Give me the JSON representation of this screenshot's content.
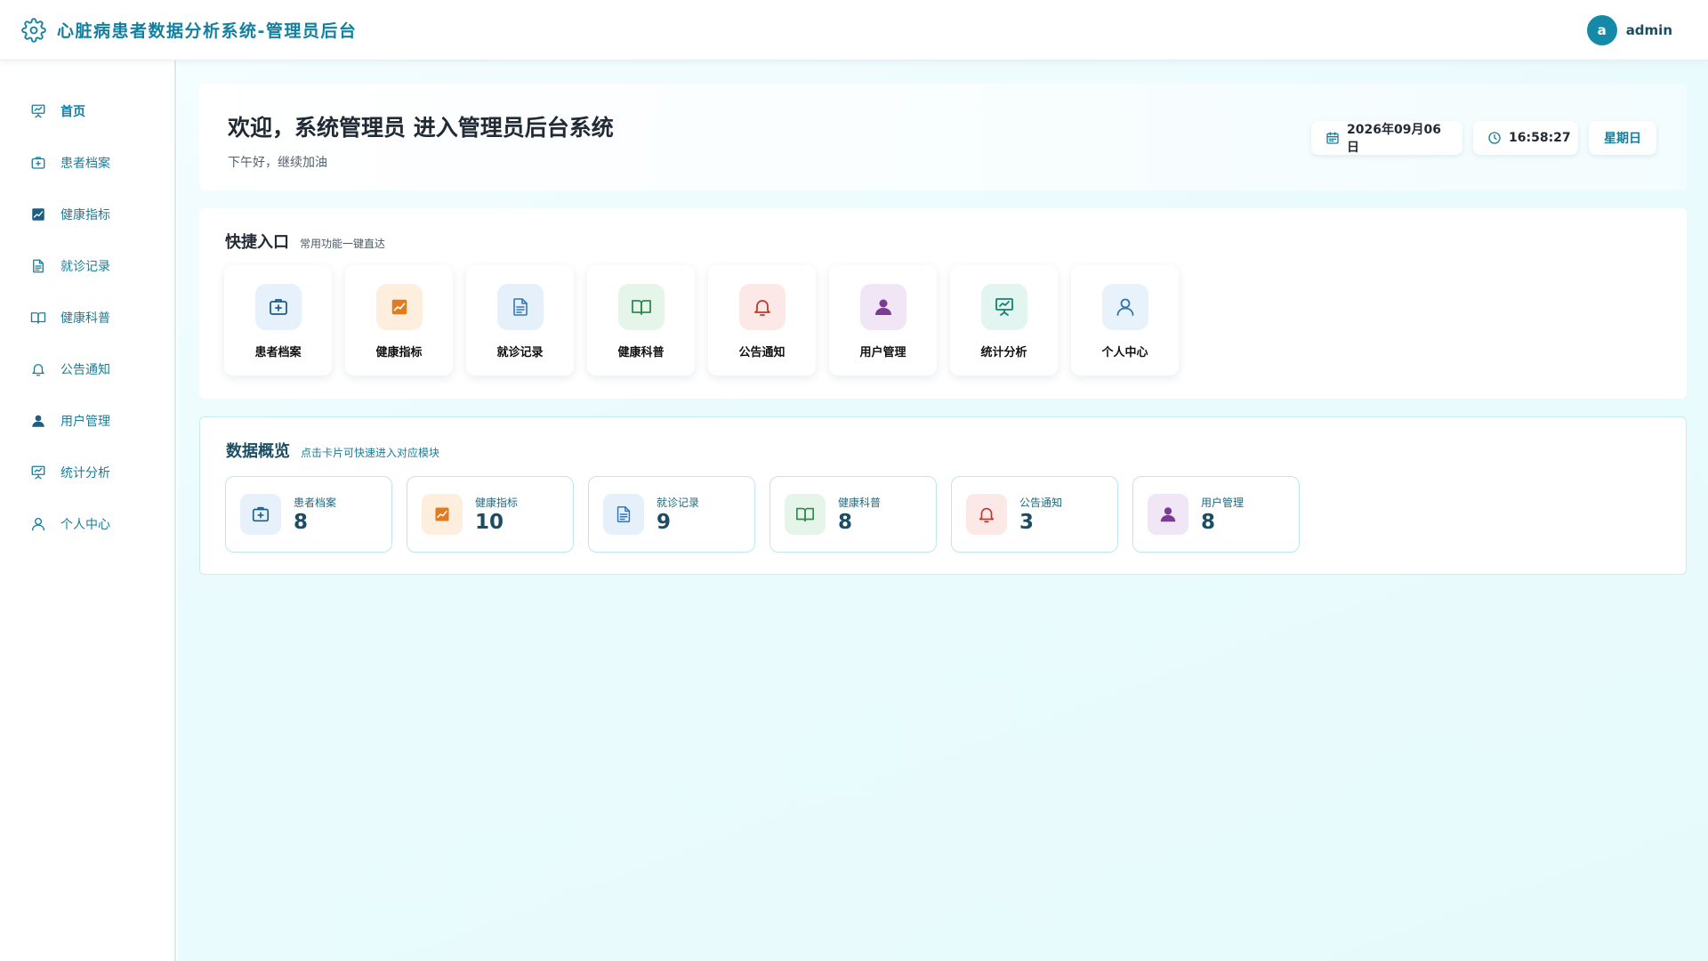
{
  "header": {
    "title": "心脏病患者数据分析系统-管理员后台",
    "logo_icon": "gear-icon",
    "avatar_letter": "a",
    "username": "admin",
    "accent": "#12809e"
  },
  "sidebar": {
    "items": [
      {
        "label": "首页",
        "icon": "presentation-icon",
        "active": true
      },
      {
        "label": "患者档案",
        "icon": "medical-kit-icon"
      },
      {
        "label": "健康指标",
        "icon": "chart-icon"
      },
      {
        "label": "就诊记录",
        "icon": "document-icon"
      },
      {
        "label": "健康科普",
        "icon": "book-icon"
      },
      {
        "label": "公告通知",
        "icon": "bell-icon"
      },
      {
        "label": "用户管理",
        "icon": "user-icon"
      },
      {
        "label": "统计分析",
        "icon": "presentation-icon"
      },
      {
        "label": "个人中心",
        "icon": "user-outline-icon"
      }
    ]
  },
  "welcome": {
    "title": "欢迎，系统管理员 进入管理员后台系统",
    "subtitle": "下午好，继续加油",
    "date": "2026年09月06日",
    "time": "16:58:27",
    "weekday": "星期日"
  },
  "quick": {
    "title": "快捷入口",
    "subtitle": "常用功能一键直达",
    "items": [
      {
        "label": "患者档案",
        "icon": "medical-kit-icon",
        "bg": "#e7f1fb",
        "color": "#1d5f82"
      },
      {
        "label": "健康指标",
        "icon": "chart-icon",
        "bg": "#fdeedd",
        "color": "#e07b1f"
      },
      {
        "label": "就诊记录",
        "icon": "document-icon",
        "bg": "#e6f0fa",
        "color": "#3378b6"
      },
      {
        "label": "健康科普",
        "icon": "book-icon",
        "bg": "#e5f5ea",
        "color": "#2e8b4c"
      },
      {
        "label": "公告通知",
        "icon": "bell-icon",
        "bg": "#fde8e8",
        "color": "#c0392b"
      },
      {
        "label": "用户管理",
        "icon": "user-icon",
        "bg": "#f1e6f6",
        "color": "#7b3a93"
      },
      {
        "label": "统计分析",
        "icon": "presentation-icon",
        "bg": "#e2f5f1",
        "color": "#16826e"
      },
      {
        "label": "个人中心",
        "icon": "user-outline-icon",
        "bg": "#e8f2fa",
        "color": "#3474a6"
      }
    ]
  },
  "overview": {
    "title": "数据概览",
    "subtitle": "点击卡片可快速进入对应模块",
    "cards": [
      {
        "label": "患者档案",
        "value": "8",
        "icon": "medical-kit-icon",
        "bg": "#e7f1fb",
        "color": "#1d5f82"
      },
      {
        "label": "健康指标",
        "value": "10",
        "icon": "chart-icon",
        "bg": "#fdeedd",
        "color": "#e07b1f"
      },
      {
        "label": "就诊记录",
        "value": "9",
        "icon": "document-icon",
        "bg": "#e6f0fa",
        "color": "#3378b6"
      },
      {
        "label": "健康科普",
        "value": "8",
        "icon": "book-icon",
        "bg": "#e5f5ea",
        "color": "#2e8b4c"
      },
      {
        "label": "公告通知",
        "value": "3",
        "icon": "bell-icon",
        "bg": "#fde8e8",
        "color": "#c0392b"
      },
      {
        "label": "用户管理",
        "value": "8",
        "icon": "user-icon",
        "bg": "#f1e6f6",
        "color": "#7b3a93"
      }
    ]
  }
}
